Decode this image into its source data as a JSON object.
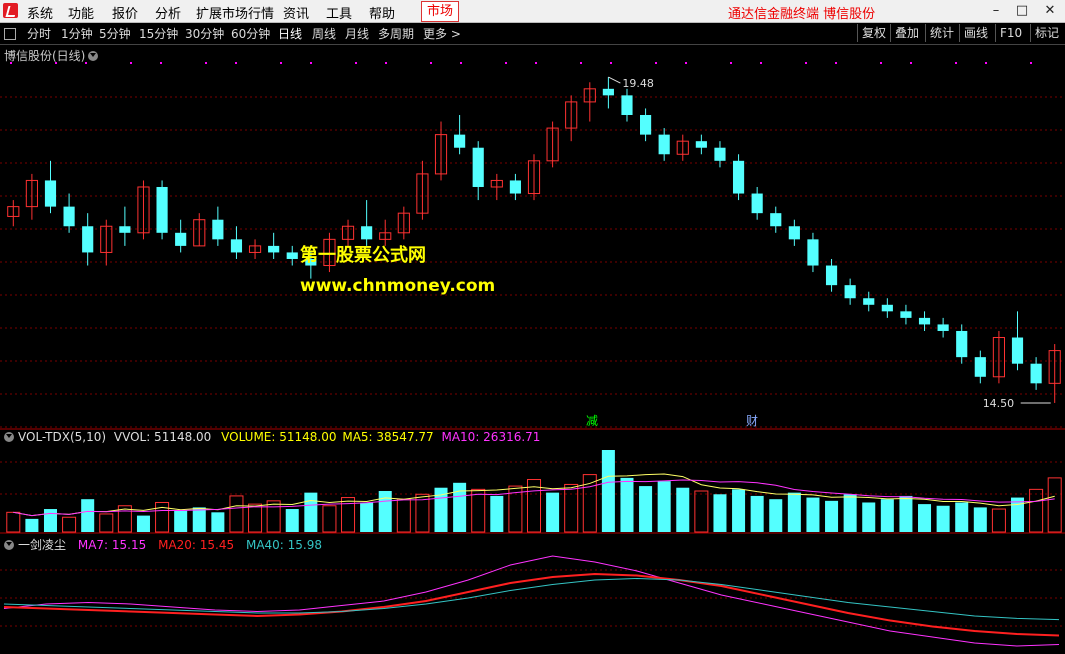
{
  "menu": {
    "items": [
      "系统",
      "功能",
      "报价",
      "分析",
      "扩展市场行情",
      "资讯",
      "工具",
      "帮助"
    ],
    "market": "市场",
    "brand": "通达信金融终端 博信股份"
  },
  "toolbar": {
    "periods": [
      "分时",
      "1分钟",
      "5分钟",
      "15分钟",
      "30分钟",
      "60分钟",
      "日线",
      "周线",
      "月线",
      "多周期",
      "更多 >"
    ],
    "active": "日线",
    "right_buttons": [
      "复权",
      "叠加",
      "统计",
      "画线",
      "F10",
      "标记"
    ]
  },
  "main_chart": {
    "title": "博信股份(日线)",
    "high_label": "19.48",
    "low_label": "14.50",
    "marker_1": "减",
    "marker_2": "财",
    "colors": {
      "up": "#ff3232",
      "down": "#54ffff",
      "grid": "#7a0000",
      "dots": "#ff00ff"
    }
  },
  "chart_data": [
    {
      "type": "candlestick",
      "title": "博信股份(日线)",
      "annotations": [
        "19.48",
        "14.50"
      ],
      "ohlc": [
        [
          17.35,
          17.6,
          17.2,
          17.5
        ],
        [
          17.5,
          18.0,
          17.3,
          17.9
        ],
        [
          17.9,
          18.2,
          17.4,
          17.5
        ],
        [
          17.5,
          17.7,
          17.1,
          17.2
        ],
        [
          17.2,
          17.4,
          16.6,
          16.8
        ],
        [
          16.8,
          17.3,
          16.6,
          17.2
        ],
        [
          17.2,
          17.5,
          16.9,
          17.1
        ],
        [
          17.1,
          17.9,
          17.0,
          17.8
        ],
        [
          17.8,
          17.9,
          17.0,
          17.1
        ],
        [
          17.1,
          17.3,
          16.8,
          16.9
        ],
        [
          16.9,
          17.4,
          16.9,
          17.3
        ],
        [
          17.3,
          17.5,
          16.9,
          17.0
        ],
        [
          17.0,
          17.2,
          16.7,
          16.8
        ],
        [
          16.8,
          17.0,
          16.7,
          16.9
        ],
        [
          16.9,
          17.1,
          16.7,
          16.8
        ],
        [
          16.8,
          16.9,
          16.6,
          16.7
        ],
        [
          16.7,
          16.8,
          16.4,
          16.6
        ],
        [
          16.6,
          17.1,
          16.5,
          17.0
        ],
        [
          17.0,
          17.3,
          16.9,
          17.2
        ],
        [
          17.2,
          17.6,
          16.9,
          17.0
        ],
        [
          17.0,
          17.3,
          16.9,
          17.1
        ],
        [
          17.1,
          17.5,
          17.0,
          17.4
        ],
        [
          17.4,
          18.2,
          17.3,
          18.0
        ],
        [
          18.0,
          18.8,
          17.9,
          18.6
        ],
        [
          18.6,
          18.9,
          18.3,
          18.4
        ],
        [
          18.4,
          18.5,
          17.6,
          17.8
        ],
        [
          17.8,
          18.0,
          17.6,
          17.9
        ],
        [
          17.9,
          18.0,
          17.6,
          17.7
        ],
        [
          17.7,
          18.3,
          17.6,
          18.2
        ],
        [
          18.2,
          18.8,
          18.1,
          18.7
        ],
        [
          18.7,
          19.2,
          18.5,
          19.1
        ],
        [
          19.1,
          19.4,
          18.8,
          19.3
        ],
        [
          19.3,
          19.48,
          19.0,
          19.2
        ],
        [
          19.2,
          19.3,
          18.8,
          18.9
        ],
        [
          18.9,
          19.0,
          18.5,
          18.6
        ],
        [
          18.6,
          18.7,
          18.2,
          18.3
        ],
        [
          18.3,
          18.6,
          18.2,
          18.5
        ],
        [
          18.5,
          18.6,
          18.3,
          18.4
        ],
        [
          18.4,
          18.5,
          18.1,
          18.2
        ],
        [
          18.2,
          18.3,
          17.6,
          17.7
        ],
        [
          17.7,
          17.8,
          17.3,
          17.4
        ],
        [
          17.4,
          17.5,
          17.1,
          17.2
        ],
        [
          17.2,
          17.3,
          16.9,
          17.0
        ],
        [
          17.0,
          17.1,
          16.5,
          16.6
        ],
        [
          16.6,
          16.7,
          16.2,
          16.3
        ],
        [
          16.3,
          16.4,
          16.0,
          16.1
        ],
        [
          16.1,
          16.2,
          15.9,
          16.0
        ],
        [
          16.0,
          16.1,
          15.8,
          15.9
        ],
        [
          15.9,
          16.0,
          15.7,
          15.8
        ],
        [
          15.8,
          15.9,
          15.6,
          15.7
        ],
        [
          15.7,
          15.8,
          15.5,
          15.6
        ],
        [
          15.6,
          15.7,
          15.1,
          15.2
        ],
        [
          15.2,
          15.3,
          14.8,
          14.9
        ],
        [
          14.9,
          15.6,
          14.8,
          15.5
        ],
        [
          15.5,
          15.9,
          15.0,
          15.1
        ],
        [
          15.1,
          15.2,
          14.7,
          14.8
        ],
        [
          14.8,
          15.4,
          14.5,
          15.3
        ]
      ]
    },
    {
      "type": "bar",
      "title": "VOL-TDX(5,10)",
      "series_labels": [
        "VVOL: 51148.00",
        "VOLUME: 51148.00",
        "MA5: 38547.77",
        "MA10: 26316.71"
      ],
      "values": [
        12,
        8,
        14,
        9,
        20,
        11,
        16,
        10,
        18,
        13,
        15,
        12,
        22,
        17,
        19,
        14,
        24,
        16,
        21,
        18,
        25,
        20,
        23,
        27,
        30,
        26,
        22,
        28,
        32,
        24,
        29,
        35,
        50,
        33,
        28,
        31,
        27,
        25,
        23,
        26,
        22,
        20,
        24,
        21,
        19,
        23,
        18,
        20,
        22,
        17,
        16,
        18,
        15,
        14,
        21,
        26,
        33
      ],
      "colors": [
        "up",
        "down",
        "down",
        "up",
        "down",
        "up",
        "up",
        "down",
        "up",
        "down",
        "down",
        "down",
        "up",
        "up",
        "up",
        "down",
        "down",
        "up",
        "up",
        "down",
        "down",
        "up",
        "up",
        "down",
        "down",
        "up",
        "down",
        "up",
        "up",
        "down",
        "up",
        "up",
        "down",
        "down",
        "down",
        "down",
        "down",
        "up",
        "down",
        "down",
        "down",
        "down",
        "down",
        "down",
        "down",
        "down",
        "down",
        "down",
        "down",
        "down",
        "down",
        "down",
        "down",
        "up",
        "down",
        "up",
        "up"
      ]
    },
    {
      "type": "line",
      "title": "一剑凌尘",
      "series": [
        {
          "name": "MA7",
          "label": "MA7: 15.15",
          "color": "#ff33ff",
          "values": [
            16.35,
            16.5,
            16.55,
            16.5,
            16.4,
            16.3,
            16.25,
            16.3,
            16.45,
            16.6,
            16.9,
            17.3,
            17.8,
            18.1,
            17.9,
            17.6,
            17.2,
            16.8,
            16.5,
            16.2,
            15.9,
            15.6,
            15.4,
            15.2,
            15.1,
            15.15
          ]
        },
        {
          "name": "MA20",
          "label": "MA20: 15.45",
          "color": "#ff2020",
          "values": [
            16.4,
            16.35,
            16.3,
            16.25,
            16.2,
            16.15,
            16.1,
            16.15,
            16.25,
            16.4,
            16.6,
            16.9,
            17.2,
            17.4,
            17.5,
            17.45,
            17.3,
            17.1,
            16.8,
            16.5,
            16.2,
            15.95,
            15.75,
            15.6,
            15.5,
            15.45
          ]
        },
        {
          "name": "MA40",
          "label": "MA40: 15.98",
          "color": "#34c4c4",
          "values": [
            16.5,
            16.45,
            16.4,
            16.35,
            16.3,
            16.25,
            16.2,
            16.2,
            16.25,
            16.35,
            16.5,
            16.7,
            16.95,
            17.15,
            17.3,
            17.35,
            17.3,
            17.15,
            16.95,
            16.75,
            16.55,
            16.4,
            16.25,
            16.1,
            16.02,
            15.98
          ]
        }
      ]
    }
  ],
  "vol_panel": {
    "name": "VOL-TDX(5,10)",
    "vvol": "VVOL: 51148.00",
    "volume": "VOLUME: 51148.00",
    "ma5": "MA5: 38547.77",
    "ma10": "MA10: 26316.71"
  },
  "ind_panel": {
    "name": "一剑凌尘",
    "ma7": "MA7: 15.15",
    "ma20": "MA20: 15.45",
    "ma40": "MA40: 15.98"
  },
  "watermark": {
    "line1": "第一股票公式网",
    "line2": "www.chnmoney.com"
  }
}
